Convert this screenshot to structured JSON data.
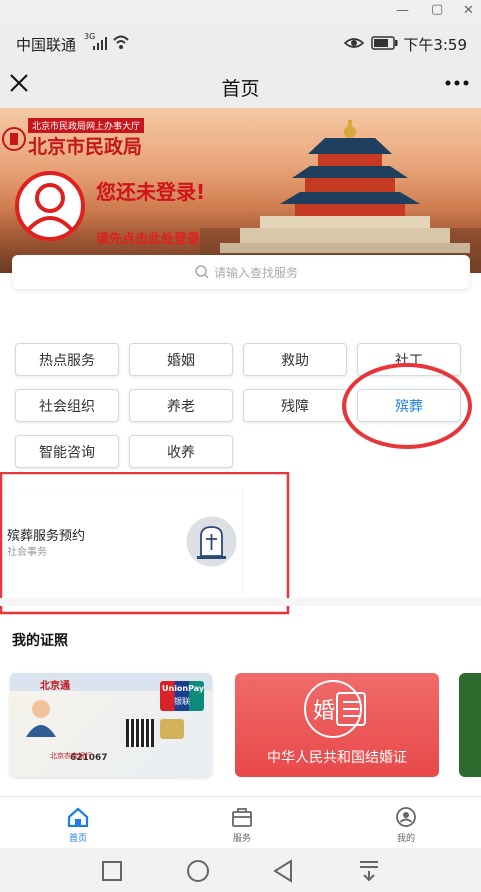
{
  "status": {
    "carrier": "中国联通",
    "network": "3G",
    "time": "下午3:59"
  },
  "nav": {
    "title": "首页"
  },
  "banner": {
    "org_caption": "北京市民政局网上办事大厅",
    "org_name": "北京市民政局",
    "login_title": "您还未登录!",
    "login_hint": "请先点击此处登录"
  },
  "search": {
    "placeholder": "请输入查找服务"
  },
  "categories": [
    {
      "label": "热点服务",
      "active": false
    },
    {
      "label": "婚姻",
      "active": false
    },
    {
      "label": "救助",
      "active": false
    },
    {
      "label": "社工",
      "active": false
    },
    {
      "label": "社会组织",
      "active": false
    },
    {
      "label": "养老",
      "active": false
    },
    {
      "label": "残障",
      "active": false
    },
    {
      "label": "殡葬",
      "active": true
    },
    {
      "label": "智能咨询",
      "active": false
    },
    {
      "label": "收养",
      "active": false
    }
  ],
  "service": {
    "title": "殡葬服务预约",
    "subtitle": "社会事务"
  },
  "certs": {
    "section_title": "我的证照",
    "card1_brand": "北京通",
    "card1_number": "621067",
    "card1_bank": "北京农商银行",
    "card1_unionpay": "UnionPay",
    "card1_unionpay_cn": "银联",
    "card2_char": "婚",
    "card2_name": "中华人民共和国结婚证"
  },
  "tabs": [
    {
      "label": "首页",
      "active": true
    },
    {
      "label": "服务",
      "active": false
    },
    {
      "label": "我的",
      "active": false
    }
  ],
  "colors": {
    "accent": "#1a7de8",
    "brand_red": "#c4161c",
    "highlight": "#e8353a"
  }
}
